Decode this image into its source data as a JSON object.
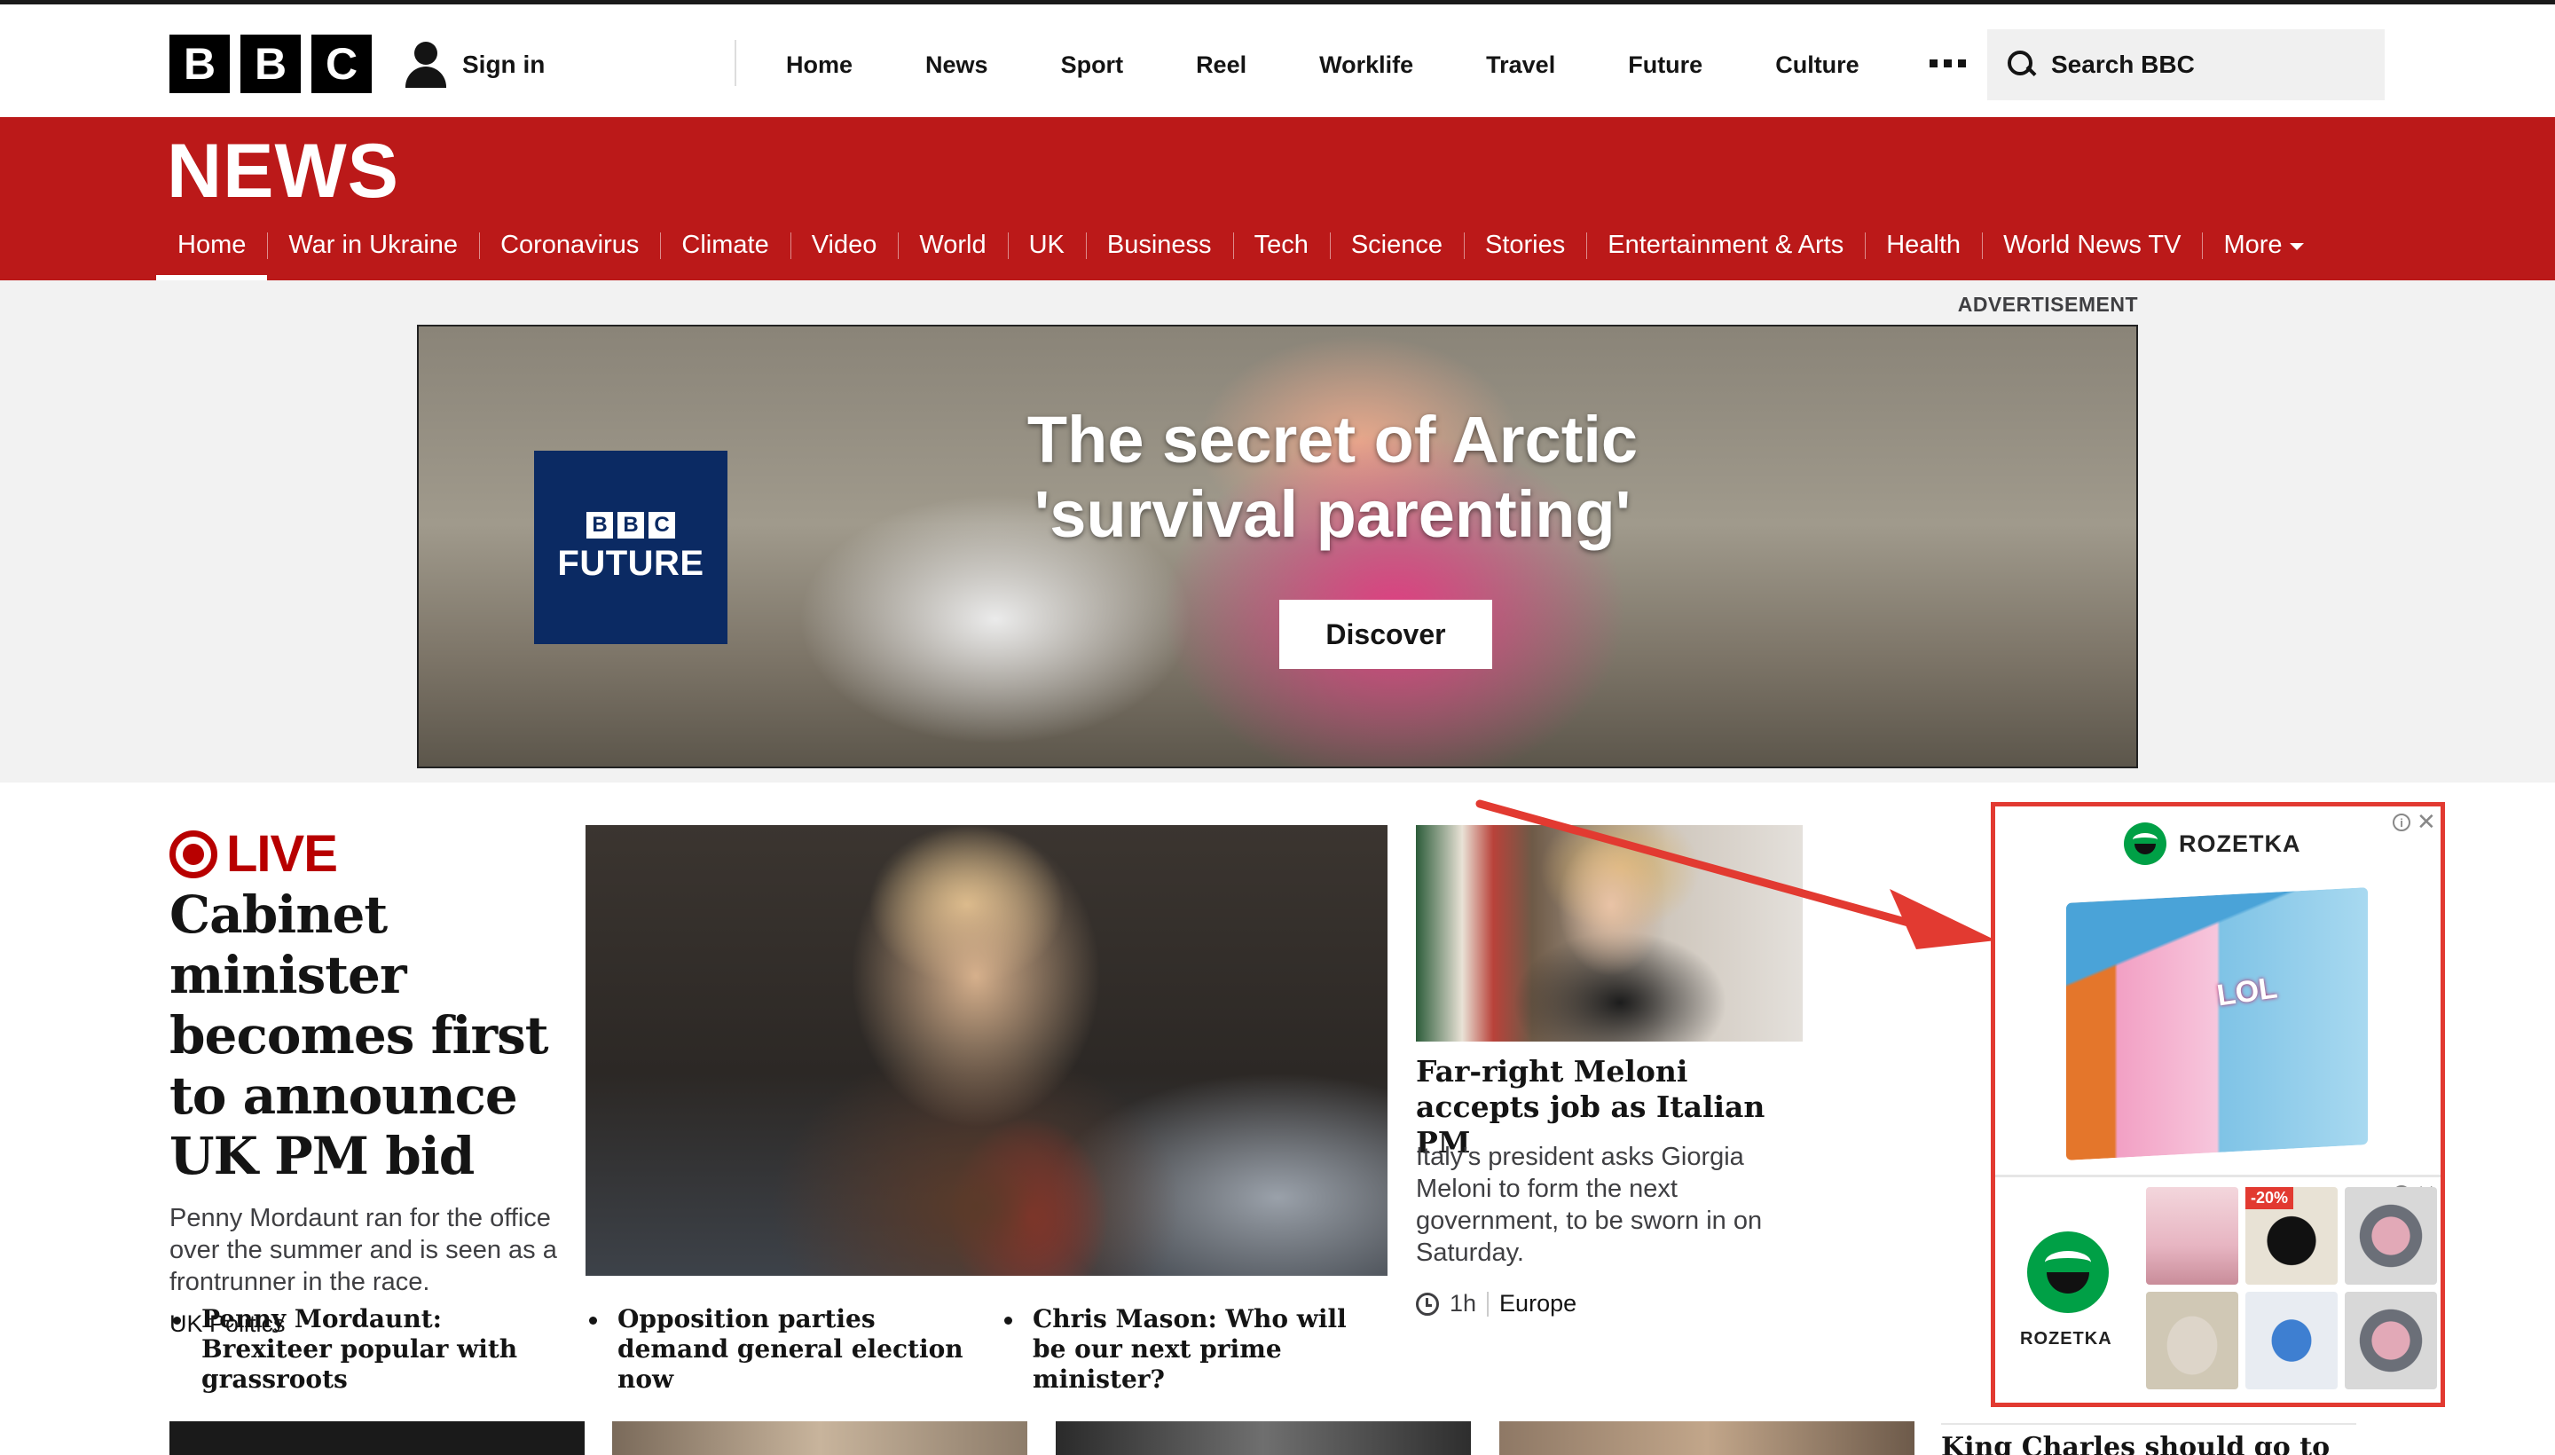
{
  "header": {
    "logo_letters": [
      "B",
      "B",
      "C"
    ],
    "signin_label": "Sign in",
    "nav": [
      "Home",
      "News",
      "Sport",
      "Reel",
      "Worklife",
      "Travel",
      "Future",
      "Culture"
    ],
    "search_placeholder": "Search BBC"
  },
  "news": {
    "title": "NEWS",
    "nav": [
      {
        "label": "Home",
        "active": true
      },
      {
        "label": "War in Ukraine"
      },
      {
        "label": "Coronavirus"
      },
      {
        "label": "Climate"
      },
      {
        "label": "Video"
      },
      {
        "label": "World"
      },
      {
        "label": "UK"
      },
      {
        "label": "Business"
      },
      {
        "label": "Tech"
      },
      {
        "label": "Science"
      },
      {
        "label": "Stories"
      },
      {
        "label": "Entertainment & Arts"
      },
      {
        "label": "Health"
      },
      {
        "label": "World News TV"
      },
      {
        "label": "More"
      }
    ]
  },
  "advert": {
    "label": "ADVERTISEMENT",
    "brand_letters": [
      "B",
      "B",
      "C"
    ],
    "brand_word": "FUTURE",
    "headline": "The secret of Arctic 'survival parenting'",
    "cta": "Discover"
  },
  "lead_story": {
    "live_label": "LIVE",
    "title": "Cabinet minister becomes first to announce UK PM bid",
    "summary": "Penny Mordaunt ran for the office over the summer and is seen as a frontrunner in the race.",
    "tag": "UK Politics"
  },
  "related": [
    "Penny Mordaunt: Brexiteer popular with grassroots",
    "Opposition parties demand general election now",
    "Chris Mason: Who will be our next prime minister?"
  ],
  "side_story": {
    "title": "Far-right Meloni accepts job as Italian PM",
    "summary": "Italy's president asks Giorgia Meloni to form the next government, to be sworn in on Saturday.",
    "time": "1h",
    "region": "Europe"
  },
  "rozetka_ad": {
    "brand": "ROZETKA",
    "product_text": "LOL",
    "bottom_brand": "ROZETKA",
    "discount": "-20%",
    "info_glyph": "i",
    "close_glyph": "✕",
    "accent_color": "#e23a31",
    "brand_color": "#00a046"
  },
  "bottom_row": {
    "partial_headline": "King Charles should go to"
  },
  "colors": {
    "news_red": "#bb1919",
    "live_red": "#b80000",
    "annotation_red": "#e23a31"
  }
}
